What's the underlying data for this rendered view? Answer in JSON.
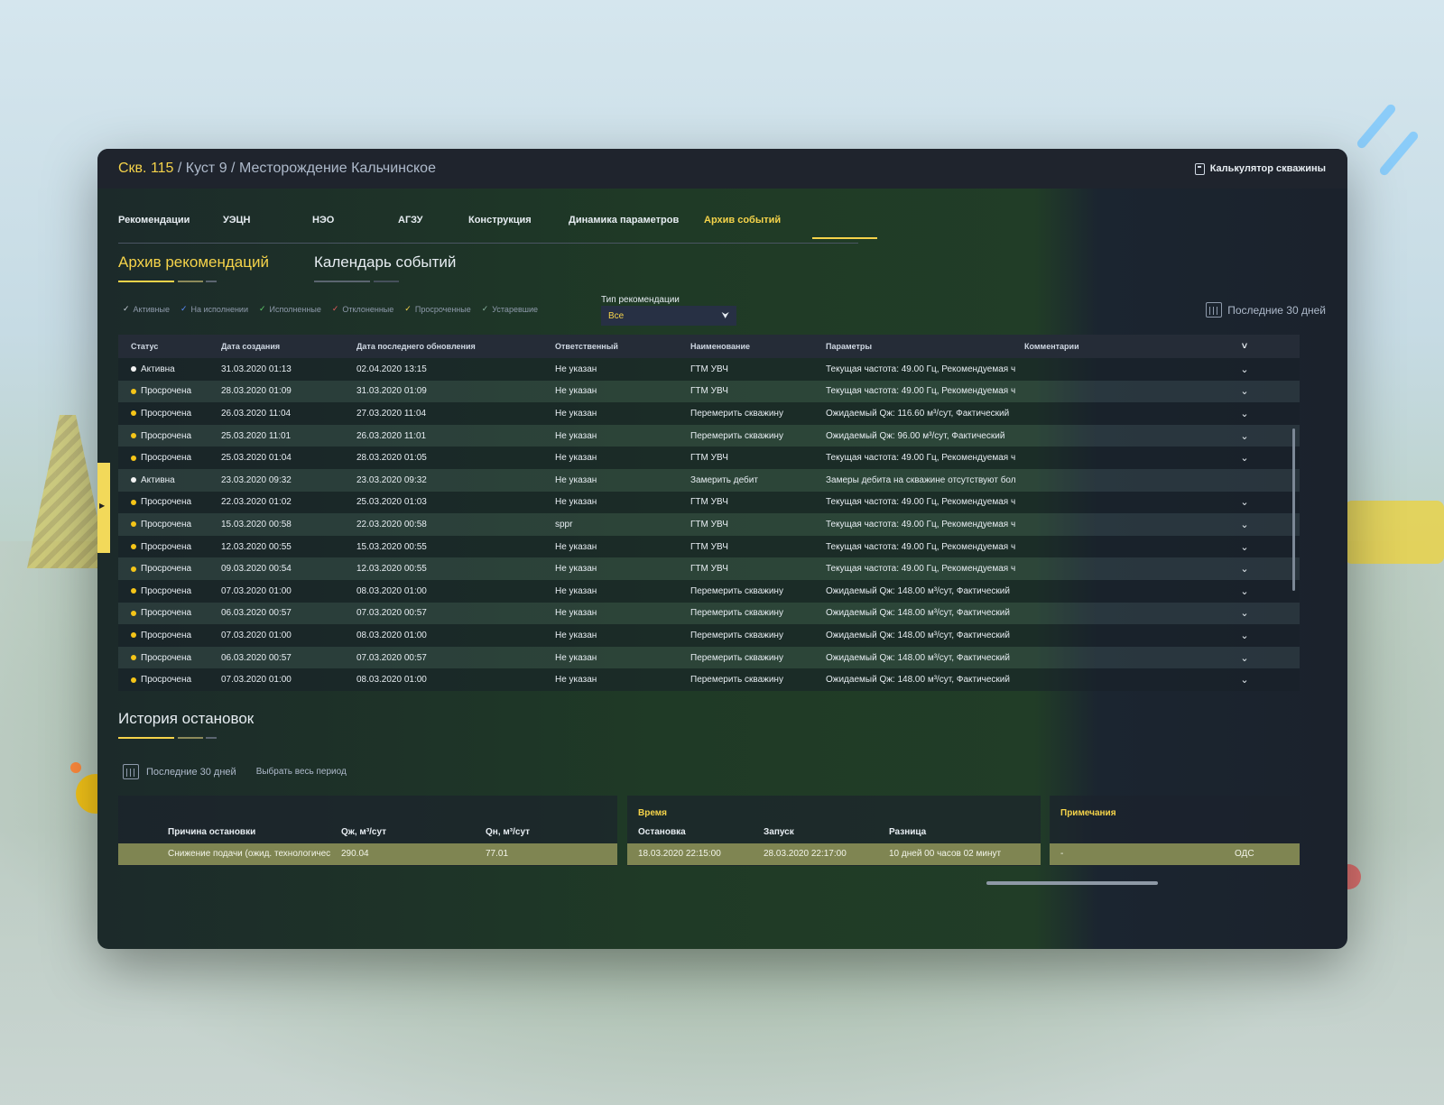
{
  "header": {
    "well": "Скв. 115",
    "path": " / Куст 9 / Месторождение Кальчинское",
    "calc_label": "Калькулятор скважины"
  },
  "tabs": [
    "Рекомендации",
    "УЭЦН",
    "НЭО",
    "АГЗУ",
    "Конструкция",
    "Динамика параметров",
    "Архив событий"
  ],
  "active_tab": "Архив событий",
  "subtabs": [
    "Архив рекомендаций",
    "Календарь событий"
  ],
  "filters": [
    {
      "label": "Активные",
      "color": "#c8d0da"
    },
    {
      "label": "На исполнении",
      "color": "#5a8cff"
    },
    {
      "label": "Исполненные",
      "color": "#5fcf6a"
    },
    {
      "label": "Отклоненные",
      "color": "#e45b5b"
    },
    {
      "label": "Просроченные",
      "color": "#f5d34a"
    },
    {
      "label": "Устаревшие",
      "color": "#8ab3a0"
    }
  ],
  "type_filter": {
    "label": "Тип рекомендации",
    "value": "Все"
  },
  "period_label": "Последние 30 дней",
  "table": {
    "headers": [
      "Статус",
      "Дата создания",
      "Дата последнего обновления",
      "Ответственный",
      "Наименование",
      "Параметры",
      "Комментарии",
      "˅"
    ],
    "rows": [
      {
        "status": "Активна",
        "created": "31.03.2020 01:13",
        "updated": "02.04.2020 13:15",
        "resp": "Не указан",
        "name": "ГТМ УВЧ",
        "params": "Текущая частота: 49.00 Гц, Рекомендуемая ч",
        "exp": "⌄"
      },
      {
        "status": "Просрочена",
        "created": "28.03.2020 01:09",
        "updated": "31.03.2020 01:09",
        "resp": "Не указан",
        "name": "ГТМ УВЧ",
        "params": "Текущая частота: 49.00 Гц, Рекомендуемая ч",
        "exp": "⌄"
      },
      {
        "status": "Просрочена",
        "created": "26.03.2020 11:04",
        "updated": "27.03.2020 11:04",
        "resp": "Не указан",
        "name": "Перемерить скважину",
        "params": "Ожидаемый Qж: 116.60 м³/сут, Фактический",
        "exp": "⌄"
      },
      {
        "status": "Просрочена",
        "created": "25.03.2020 11:01",
        "updated": "26.03.2020 11:01",
        "resp": "Не указан",
        "name": "Перемерить скважину",
        "params": "Ожидаемый Qж: 96.00 м³/сут, Фактический",
        "exp": "⌄"
      },
      {
        "status": "Просрочена",
        "created": "25.03.2020 01:04",
        "updated": "28.03.2020 01:05",
        "resp": "Не указан",
        "name": "ГТМ УВЧ",
        "params": "Текущая частота: 49.00 Гц, Рекомендуемая ч",
        "exp": "⌄"
      },
      {
        "status": "Активна",
        "created": "23.03.2020 09:32",
        "updated": "23.03.2020 09:32",
        "resp": "Не указан",
        "name": "Замерить дебит",
        "params": "Замеры дебита на скважине отсутствуют бол",
        "exp": ""
      },
      {
        "status": "Просрочена",
        "created": "22.03.2020 01:02",
        "updated": "25.03.2020 01:03",
        "resp": "Не указан",
        "name": "ГТМ УВЧ",
        "params": "Текущая частота: 49.00 Гц, Рекомендуемая ч",
        "exp": "⌄"
      },
      {
        "status": "Просрочена",
        "created": "15.03.2020 00:58",
        "updated": "22.03.2020 00:58",
        "resp": "sppr",
        "name": "ГТМ УВЧ",
        "params": "Текущая частота: 49.00 Гц, Рекомендуемая ч",
        "exp": "⌄"
      },
      {
        "status": "Просрочена",
        "created": "12.03.2020 00:55",
        "updated": "15.03.2020 00:55",
        "resp": "Не указан",
        "name": "ГТМ УВЧ",
        "params": "Текущая частота: 49.00 Гц, Рекомендуемая ч",
        "exp": "⌄"
      },
      {
        "status": "Просрочена",
        "created": "09.03.2020 00:54",
        "updated": "12.03.2020 00:55",
        "resp": "Не указан",
        "name": "ГТМ УВЧ",
        "params": "Текущая частота: 49.00 Гц, Рекомендуемая ч",
        "exp": "⌄"
      },
      {
        "status": "Просрочена",
        "created": "07.03.2020 01:00",
        "updated": "08.03.2020 01:00",
        "resp": "Не указан",
        "name": "Перемерить скважину",
        "params": "Ожидаемый Qж: 148.00 м³/сут, Фактический",
        "exp": "⌄"
      },
      {
        "status": "Просрочена",
        "created": "06.03.2020 00:57",
        "updated": "07.03.2020 00:57",
        "resp": "Не указан",
        "name": "Перемерить скважину",
        "params": "Ожидаемый Qж: 148.00 м³/сут, Фактический",
        "exp": "⌄"
      },
      {
        "status": "Просрочена",
        "created": "07.03.2020 01:00",
        "updated": "08.03.2020 01:00",
        "resp": "Не указан",
        "name": "Перемерить скважину",
        "params": "Ожидаемый Qж: 148.00 м³/сут, Фактический",
        "exp": "⌄"
      },
      {
        "status": "Просрочена",
        "created": "06.03.2020 00:57",
        "updated": "07.03.2020 00:57",
        "resp": "Не указан",
        "name": "Перемерить скважину",
        "params": "Ожидаемый Qж: 148.00 м³/сут, Фактический",
        "exp": "⌄"
      },
      {
        "status": "Просрочена",
        "created": "07.03.2020 01:00",
        "updated": "08.03.2020 01:00",
        "resp": "Не указан",
        "name": "Перемерить скважину",
        "params": "Ожидаемый Qж: 148.00 м³/сут, Фактический",
        "exp": "⌄"
      }
    ]
  },
  "status_colors": {
    "Активна": "#f2f2f2",
    "Просрочена": "#f5c518"
  },
  "history": {
    "title": "История остановок",
    "period_label": "Последние 30 дней",
    "all_label": "Выбрать весь период",
    "left_headers": [
      "Причина остановки",
      "Qж, м³/сут",
      "Qн, м³/сут"
    ],
    "time_title": "Время",
    "time_headers": [
      "Остановка",
      "Запуск",
      "Разница"
    ],
    "notes_title": "Примечания",
    "row": {
      "reason": "Снижение подачи (ожид. технологичес",
      "qzh": "290.04",
      "qn": "77.01",
      "stop": "18.03.2020 22:15:00",
      "start": "28.03.2020 22:17:00",
      "diff": "10 дней 00 часов 02 минут",
      "note": "-",
      "source": "ОДС"
    }
  }
}
